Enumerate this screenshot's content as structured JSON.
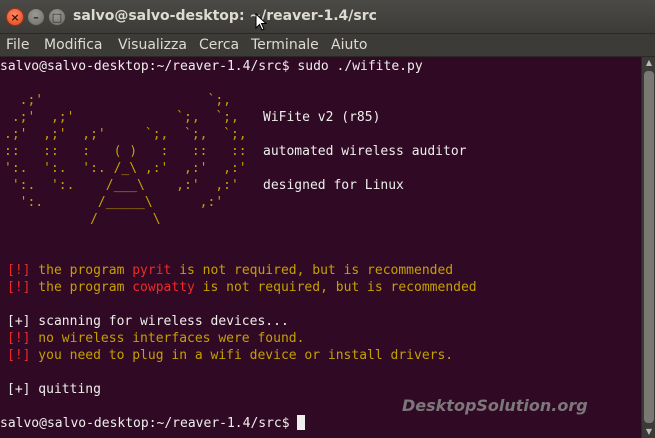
{
  "window": {
    "title": "salvo@salvo-desktop: ~/reaver-1.4/src",
    "buttons": {
      "close": "×",
      "minimize": "–",
      "maximize": "□"
    }
  },
  "menu": [
    "File",
    "Modifica",
    "Visualizza",
    "Cerca",
    "Terminale",
    "Aiuto"
  ],
  "terminal": {
    "prompt_command": "salvo@salvo-desktop:~/reaver-1.4/src$ sudo ./wifite.py",
    "banner": {
      "art": [
        "  .;'                     `;,",
        " .;'  ,;'             `;,  `;,",
        ".;'  ,;'  ,;'     `;,  `;,  `;,",
        "::   ::   :   ( )   :   ::   ::",
        "':.  ':.  ':. /_\\ ,:'  ,:'  ,:'",
        " ':.  ':.    /___\\    ,:'  ,:'",
        "  ':.       /_____\\      ,:'",
        "           /       \\"
      ],
      "title": "WiFite v2 (r85)",
      "subtitle": "automated wireless auditor",
      "tagline": "designed for Linux"
    },
    "warnings": [
      {
        "tag": "[!]",
        "pre": " the program ",
        "name": "pyrit",
        "post": " is not required, but is recommended"
      },
      {
        "tag": "[!]",
        "pre": " the program ",
        "name": "cowpatty",
        "post": " is not required, but is recommended"
      }
    ],
    "scanning": {
      "tag": "[+]",
      "text": " scanning for wireless devices..."
    },
    "errors": [
      {
        "tag": "[!]",
        "text": " no wireless interfaces were found."
      },
      {
        "tag": "[!]",
        "text": " you need to plug in a wifi device or install drivers."
      }
    ],
    "quitting": {
      "tag": "[+]",
      "text": " quitting"
    },
    "final_prompt": "salvo@salvo-desktop:~/reaver-1.4/src$ "
  },
  "watermark": "DesktopSolution.org",
  "colors": {
    "terminal_bg": "#300a24",
    "text": "#eeeeec",
    "red": "#ef2929",
    "yellow": "#c4a000"
  }
}
